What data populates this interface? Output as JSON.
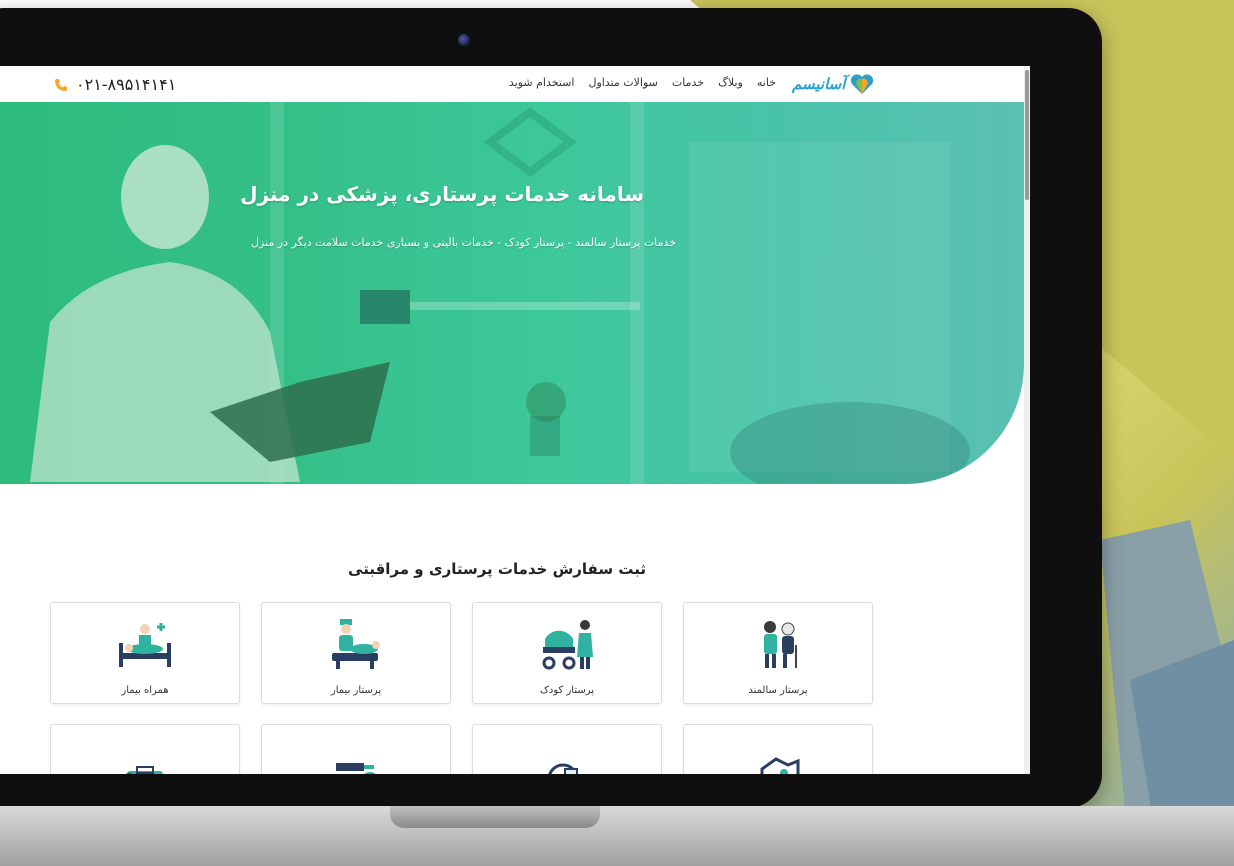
{
  "site": {
    "logo_text": "آسانیسم",
    "nav": [
      "خانه",
      "وبلاگ",
      "خدمات",
      "سوالات متداول",
      "استخدام شوید"
    ],
    "phone": "۰۲۱-۸۹۵۱۴۱۴۱"
  },
  "hero": {
    "title": "سامانه خدمات پرستاری، پزشکی در منزل",
    "subtitle": "خدمات پرستار سالمند - پرستار کودک - خدمات بالینی و بسیاری خدمات سلامت دیگر در منزل"
  },
  "services": {
    "title": "ثبت سفارش خدمات پرستاری و مراقبتی",
    "items": [
      {
        "label": "پرستار سالمند",
        "icon": "elderly-caregiver-icon"
      },
      {
        "label": "پرستار کودک",
        "icon": "baby-stroller-icon"
      },
      {
        "label": "پرستار بیمار",
        "icon": "nurse-patient-icon"
      },
      {
        "label": "همراه بیمار",
        "icon": "hospital-bed-icon"
      },
      {
        "label": "",
        "icon": "handshake-icon"
      },
      {
        "label": "",
        "icon": "medical-device-icon"
      },
      {
        "label": "",
        "icon": "injection-icon"
      },
      {
        "label": "",
        "icon": "medical-kit-icon"
      }
    ]
  },
  "colors": {
    "hero_start": "#2fc07f",
    "hero_end": "#5bc0b2",
    "brand": "#2a9fd0",
    "accent": "#f5a623"
  }
}
